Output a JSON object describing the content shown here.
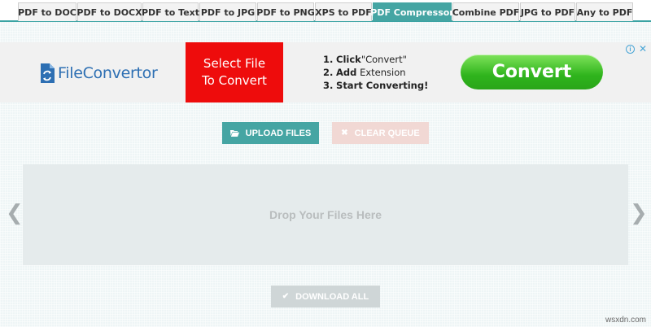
{
  "tabs": [
    {
      "label": "PDF to DOC",
      "active": false
    },
    {
      "label": "PDF to DOCX",
      "active": false
    },
    {
      "label": "PDF to Text",
      "active": false
    },
    {
      "label": "PDF to JPG",
      "active": false
    },
    {
      "label": "PDF to PNG",
      "active": false
    },
    {
      "label": "XPS to PDF",
      "active": false
    },
    {
      "label": "PDF Compressor",
      "active": true
    },
    {
      "label": "Combine PDF",
      "active": false
    },
    {
      "label": "JPG to PDF",
      "active": false
    },
    {
      "label": "Any to PDF",
      "active": false
    }
  ],
  "ad": {
    "logo_text": "FileConvertor",
    "cta_line1": "Select File",
    "cta_line2": "To Convert",
    "steps": [
      {
        "num": "1.",
        "bold": "Click",
        "rest": "\"Convert\""
      },
      {
        "num": "2.",
        "bold": "Add",
        "rest": "Extension"
      },
      {
        "num": "3.",
        "bold": "Start Converting!",
        "rest": ""
      }
    ],
    "convert_label": "Convert",
    "info_icon": "i",
    "close_icon": "✕"
  },
  "toolbar": {
    "upload_label": "UPLOAD FILES",
    "clear_label": "CLEAR QUEUE",
    "download_label": "DOWNLOAD ALL"
  },
  "dropzone": {
    "text": "Drop Your Files Here"
  },
  "nav": {
    "prev": "❮",
    "next": "❯"
  },
  "watermark": "wsxdn.com",
  "colors": {
    "accent": "#45a5a3",
    "ad_red": "#ee0c0c",
    "ad_green": "#2fb41c"
  }
}
